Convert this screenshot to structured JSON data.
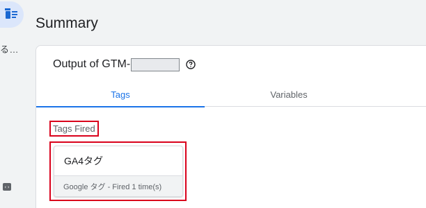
{
  "rail": {
    "truncated_text": "る…",
    "code_icon": "‹›"
  },
  "page": {
    "title": "Summary"
  },
  "output": {
    "label": "Output of GTM-"
  },
  "tabs": [
    {
      "label": "Tags",
      "active": true
    },
    {
      "label": "Variables",
      "active": false
    }
  ],
  "tags_fired": {
    "heading": "Tags Fired",
    "items": [
      {
        "name": "GA4タグ",
        "detail": "Google タグ - Fired 1 time(s)"
      }
    ]
  },
  "colors": {
    "accent": "#1a73e8",
    "highlight": "#d9001b"
  }
}
